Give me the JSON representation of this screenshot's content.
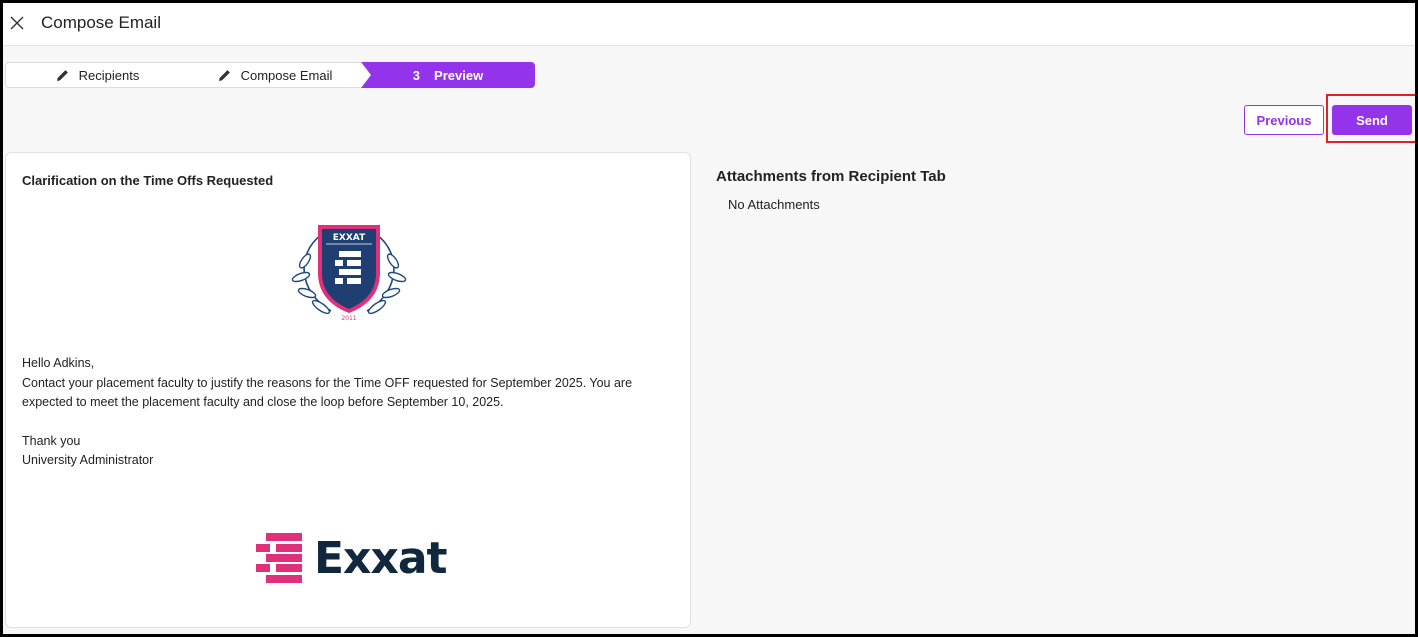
{
  "header": {
    "title": "Compose Email",
    "close_icon": "close-icon"
  },
  "stepper": {
    "steps": [
      {
        "label": "Recipients",
        "icon": "pencil-icon",
        "state": "done"
      },
      {
        "label": "Compose Email",
        "icon": "pencil-icon",
        "state": "done"
      },
      {
        "number": "3",
        "label": "Preview",
        "state": "active"
      }
    ]
  },
  "actions": {
    "previous_label": "Previous",
    "send_label": "Send"
  },
  "email": {
    "subject": "Clarification on the Time Offs Requested",
    "seal_logo": {
      "banner": "EXXAT",
      "year": "2011"
    },
    "greeting": "Hello Adkins,",
    "body": "Contact your placement faculty to justify the reasons for the Time OFF requested for September 2025. You are expected to meet the placement faculty and close the loop before September 10, 2025.",
    "signoff": "Thank you",
    "signature": "University Administrator",
    "footer_logo_text": "Exxat"
  },
  "attachments": {
    "title": "Attachments from Recipient Tab",
    "empty_text": "No Attachments"
  },
  "colors": {
    "accent": "#9333ea",
    "highlight": "#e0202a",
    "brand_navy": "#10273d",
    "brand_pink": "#e0307a"
  }
}
